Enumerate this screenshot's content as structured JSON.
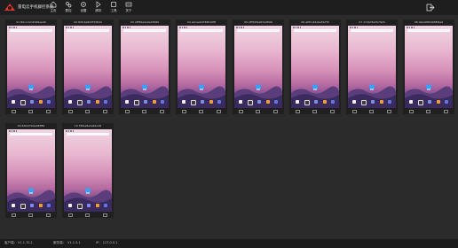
{
  "app": {
    "title": "雷电云手机群控系统"
  },
  "nav": [
    {
      "label": "主页",
      "icon": "home-icon"
    },
    {
      "label": "群控",
      "icon": "group-control-icon"
    },
    {
      "label": "设置",
      "icon": "settings-icon"
    },
    {
      "label": "脚本",
      "icon": "script-icon"
    },
    {
      "label": "工具",
      "icon": "tools-icon"
    },
    {
      "label": "关于",
      "icon": "about-icon"
    }
  ],
  "devices": [
    {
      "title": "01 N2comm2946ee40"
    },
    {
      "title": "02 8dfc4e8a5f3d84d"
    },
    {
      "title": "03 c8f89e2e0e23680"
    },
    {
      "title": "04 ebcaeb9768010f8"
    },
    {
      "title": "05 2f850fe097a9899"
    },
    {
      "title": "06 a6f1c4da0e5b7f0"
    },
    {
      "title": "07 17d0c8a2b7920"
    },
    {
      "title": "08 0aba6894938f2a0"
    },
    {
      "title": "09 6dfa47b0e36ff8d"
    },
    {
      "title": "10 3f91a8e2a6bc28"
    }
  ],
  "status": {
    "client_label": "客户端：",
    "client_version": "V1.1.70.1",
    "server_label": "服务端：",
    "server_version": "V1.1.5.1",
    "extra": "IP： 127.0.0.1"
  },
  "colors": {
    "accent": "#e0352b",
    "wallpaper_top": "#f0d4e2",
    "wallpaper_bottom": "#3d2d65"
  }
}
